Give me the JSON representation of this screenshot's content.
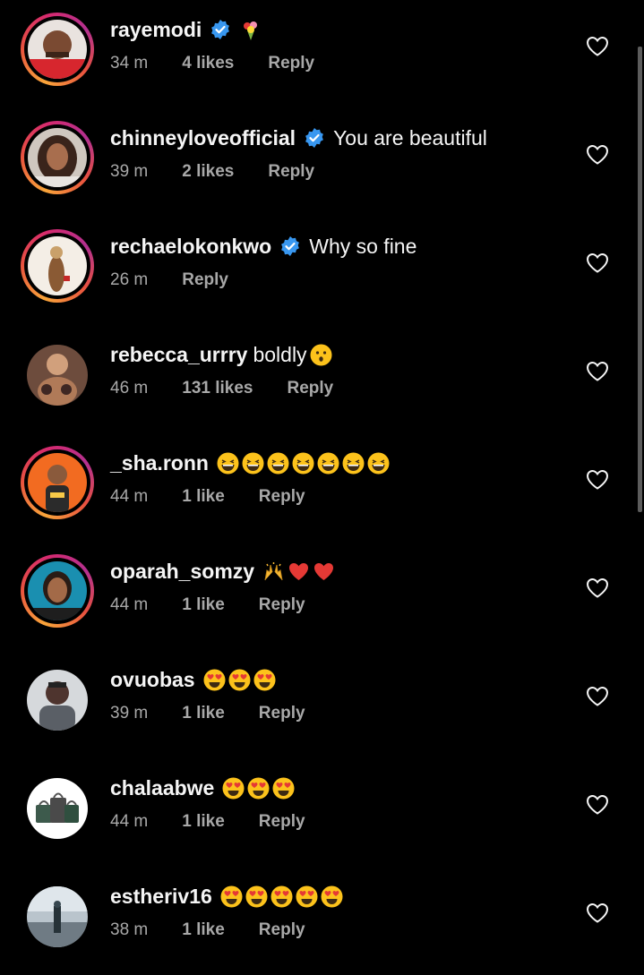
{
  "colors": {
    "background": "#000000",
    "primary_text": "#f5f5f5",
    "secondary_text": "#a8a8a8",
    "verified_badge": "#3897f0",
    "story_ring": "#e1306c"
  },
  "icons": {
    "verified": "verified-badge-icon",
    "like": "heart-outline-icon"
  },
  "comments": [
    {
      "username": "rayemodi",
      "verified": true,
      "text": "",
      "emoji": [
        "bouquet"
      ],
      "time": "34 m",
      "likes": "4 likes",
      "reply": "Reply",
      "story_ring": true
    },
    {
      "username": "chinneyloveofficial",
      "verified": true,
      "text": "You are beautiful",
      "emoji": [],
      "time": "39 m",
      "likes": "2 likes",
      "reply": "Reply",
      "story_ring": true
    },
    {
      "username": "rechaelokonkwo",
      "verified": true,
      "text": "Why so fine",
      "emoji": [],
      "time": "26 m",
      "likes": "",
      "reply": "Reply",
      "story_ring": true
    },
    {
      "username": "rebecca_urrry",
      "verified": false,
      "text": "boldly",
      "emoji": [
        "hushed-face"
      ],
      "time": "46 m",
      "likes": "131 likes",
      "reply": "Reply",
      "story_ring": false
    },
    {
      "username": "_sha.ronn",
      "verified": false,
      "text": "",
      "emoji": [
        "grinning-squint",
        "grinning-squint",
        "grinning-squint",
        "grinning-squint",
        "grinning-squint",
        "grinning-squint",
        "grinning-squint"
      ],
      "time": "44 m",
      "likes": "1 like",
      "reply": "Reply",
      "story_ring": true
    },
    {
      "username": "oparah_somzy",
      "verified": false,
      "text": "",
      "emoji": [
        "raising-hands",
        "red-heart",
        "red-heart"
      ],
      "time": "44 m",
      "likes": "1 like",
      "reply": "Reply",
      "story_ring": true
    },
    {
      "username": "ovuobas",
      "verified": false,
      "text": "",
      "emoji": [
        "heart-eyes",
        "heart-eyes",
        "heart-eyes"
      ],
      "time": "39 m",
      "likes": "1 like",
      "reply": "Reply",
      "story_ring": false
    },
    {
      "username": "chalaabwe",
      "verified": false,
      "text": "",
      "emoji": [
        "heart-eyes",
        "heart-eyes",
        "heart-eyes"
      ],
      "time": "44 m",
      "likes": "1 like",
      "reply": "Reply",
      "story_ring": false
    },
    {
      "username": "estheriv16",
      "verified": false,
      "text": "",
      "emoji": [
        "heart-eyes",
        "heart-eyes",
        "heart-eyes",
        "heart-eyes",
        "heart-eyes"
      ],
      "time": "38 m",
      "likes": "1 like",
      "reply": "Reply",
      "story_ring": false
    }
  ]
}
